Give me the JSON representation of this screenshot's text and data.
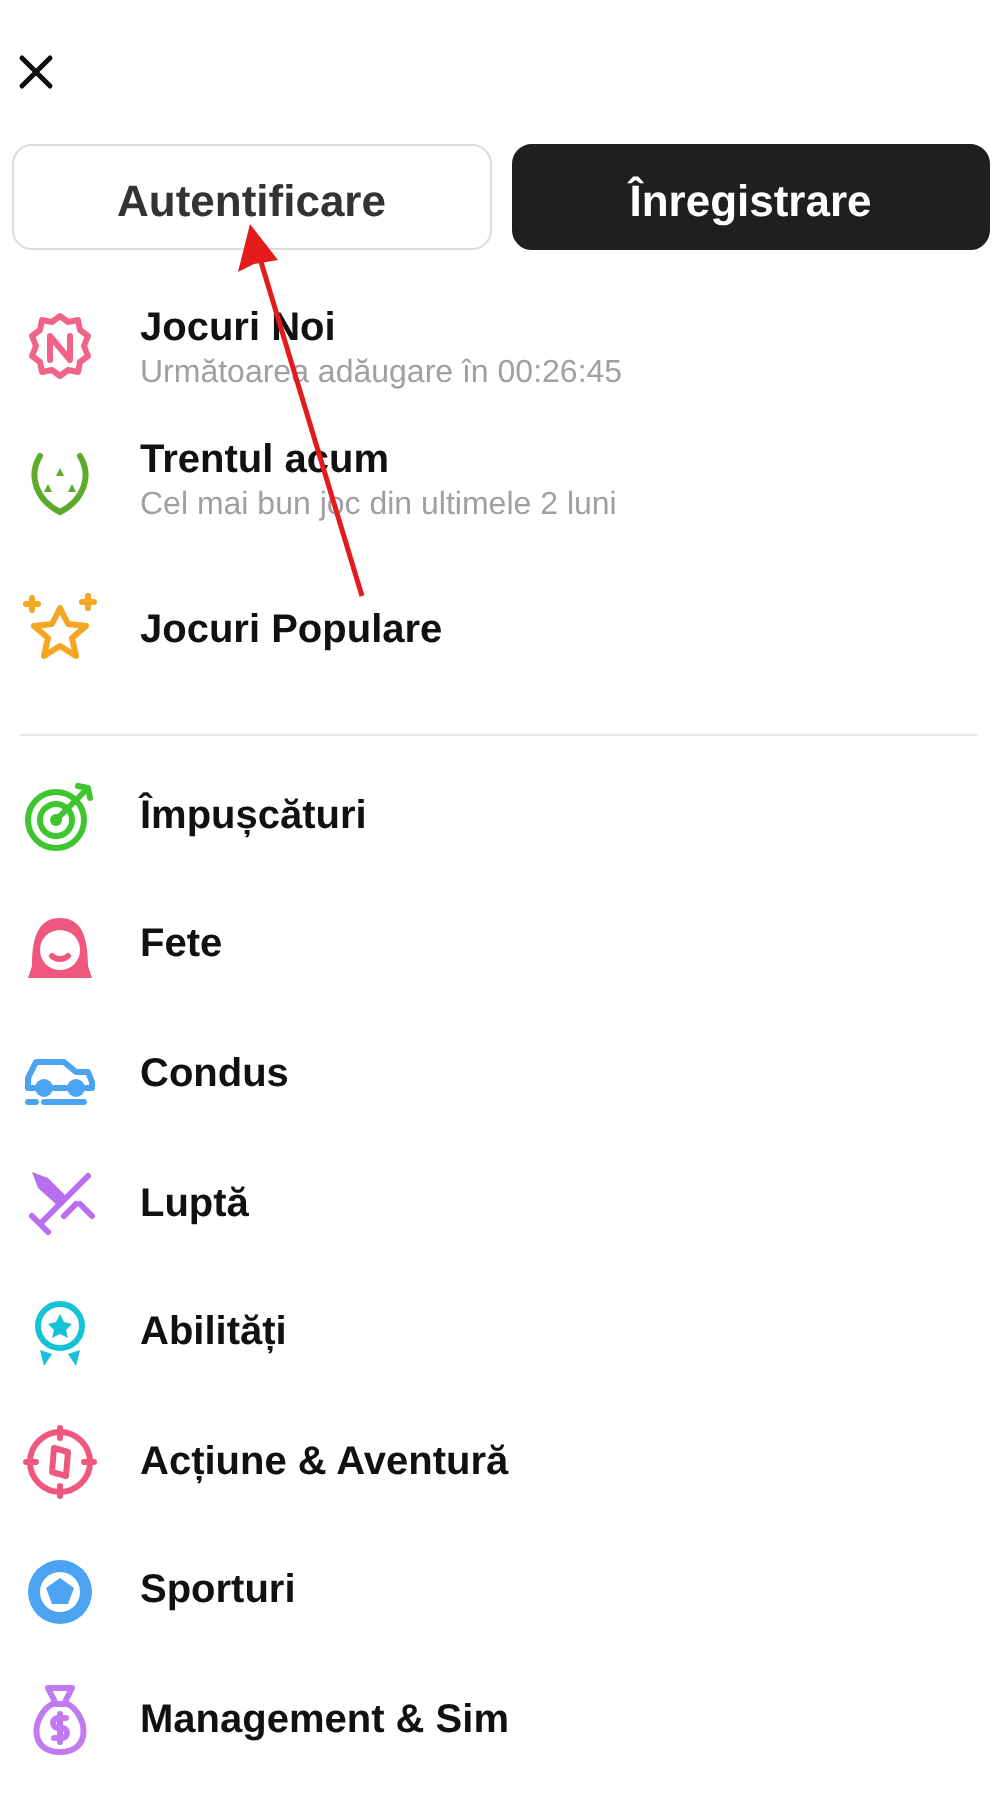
{
  "auth_buttons": [
    {
      "label": "Autentificare",
      "kind": "outline"
    },
    {
      "label": "Înregistrare",
      "kind": "filled"
    }
  ],
  "featured": [
    {
      "title": "Jocuri Noi",
      "subtitle": "Următoarea adăugare în 00:26:45"
    },
    {
      "title": "Trentul acum",
      "subtitle": "Cel mai bun joc din ultimele 2 luni"
    },
    {
      "title": "Jocuri Populare"
    }
  ],
  "categories": [
    {
      "title": "Împușcături"
    },
    {
      "title": "Fete"
    },
    {
      "title": "Condus"
    },
    {
      "title": "Luptă"
    },
    {
      "title": "Abilități"
    },
    {
      "title": "Acțiune & Aventură"
    },
    {
      "title": "Sporturi"
    },
    {
      "title": "Management & Sim"
    }
  ]
}
